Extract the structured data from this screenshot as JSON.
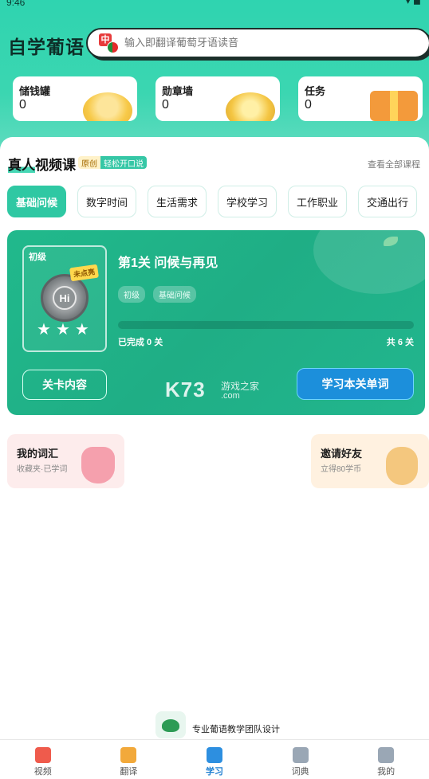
{
  "status": {
    "time": "9:46",
    "icons": "▾ ◼"
  },
  "header": {
    "title": "自学葡语",
    "search_placeholder": "输入即翻译葡萄牙语读音",
    "search_icon_text": "中"
  },
  "quick_cards": [
    {
      "label": "储钱罐",
      "value": "0",
      "icon": "coin-jar-icon",
      "color": "#f7c948"
    },
    {
      "label": "勋章墙",
      "value": "0",
      "icon": "medal-icon",
      "color": "#f4c542"
    },
    {
      "label": "任务",
      "value": "0",
      "icon": "gift-icon",
      "color": "#f39a3b"
    }
  ],
  "section": {
    "title": "真人视频课",
    "title_highlight": "真人",
    "title_rest": "视频课",
    "badge_original": "原创",
    "badge_oral": "轻松开口说",
    "view_all": "查看全部课程"
  },
  "tabs": [
    {
      "label": "基础问候",
      "active": true
    },
    {
      "label": "数字时间",
      "active": false
    },
    {
      "label": "生活需求",
      "active": false
    },
    {
      "label": "学校学习",
      "active": false
    },
    {
      "label": "工作职业",
      "active": false
    },
    {
      "label": "交通出行",
      "active": false
    }
  ],
  "lesson": {
    "level_tag": "初级",
    "ribbon": "未点亮",
    "badge_text": "Hi",
    "title": "第1关 问候与再见",
    "chips": [
      "初级",
      "基础问候"
    ],
    "progress": 0,
    "completed_text": "已完成 0 关",
    "total_text": "共 6 关",
    "stars": [
      "★",
      "★",
      "★"
    ],
    "btn_content": "关卡内容",
    "btn_study": "学习本关单词"
  },
  "watermark": {
    "logo": "K73",
    "text": "游戏之家",
    "domain": ".com"
  },
  "mini_cards": [
    {
      "title": "我的词汇",
      "subtitle": "收藏夹·已学词",
      "bg": "#fdecec"
    },
    {
      "title": "邀请好友",
      "subtitle": "立得80学币",
      "bg": "#fff1e0"
    }
  ],
  "footer": {
    "team_text": "专业葡语教学团队设计"
  },
  "bottom_nav": [
    {
      "label": "视频",
      "icon": "video-icon",
      "color": "#ef5b4c",
      "active": false
    },
    {
      "label": "翻译",
      "icon": "translate-icon",
      "color": "#f2a93b",
      "active": false
    },
    {
      "label": "学习",
      "icon": "book-icon",
      "color": "#2d8fe0",
      "active": true
    },
    {
      "label": "词典",
      "icon": "dictionary-icon",
      "color": "#9aa7b5",
      "active": false
    },
    {
      "label": "我的",
      "icon": "profile-icon",
      "color": "#9aa7b5",
      "active": false
    }
  ]
}
